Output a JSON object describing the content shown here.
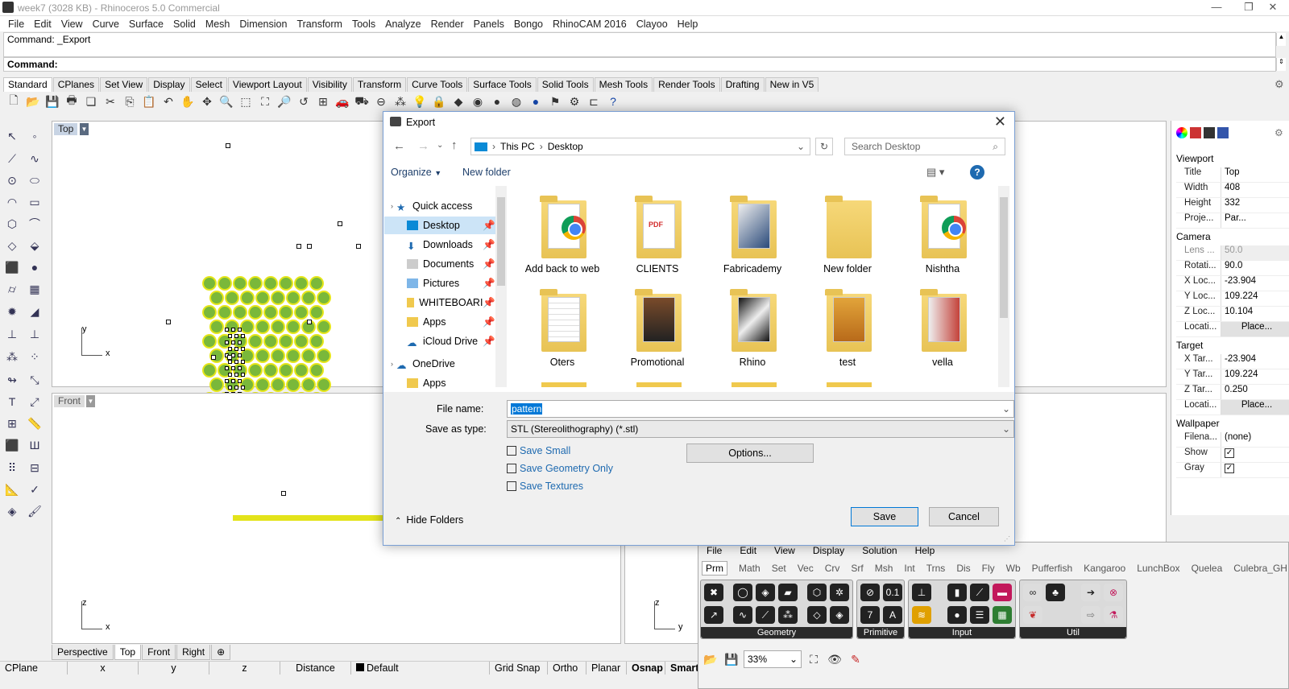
{
  "window": {
    "title": "week7 (3028 KB) - Rhinoceros 5.0 Commercial"
  },
  "menu": [
    "File",
    "Edit",
    "View",
    "Curve",
    "Surface",
    "Solid",
    "Mesh",
    "Dimension",
    "Transform",
    "Tools",
    "Analyze",
    "Render",
    "Panels",
    "Bongo",
    "RhinoCAM 2016",
    "Clayoo",
    "Help"
  ],
  "command": {
    "history": "Command: _Export",
    "prompt": "Command:"
  },
  "toolbar_tabs": [
    "Standard",
    "CPlanes",
    "Set View",
    "Display",
    "Select",
    "Viewport Layout",
    "Visibility",
    "Transform",
    "Curve Tools",
    "Surface Tools",
    "Solid Tools",
    "Mesh Tools",
    "Render Tools",
    "Drafting",
    "New in V5"
  ],
  "viewports": {
    "top": "Top",
    "front": "Front",
    "axis_y": "y",
    "axis_x": "x",
    "axis_z": "z"
  },
  "viewport_tabs": [
    "Perspective",
    "Top",
    "Front",
    "Right"
  ],
  "statusbar": [
    "CPlane",
    "x",
    "y",
    "z",
    "Distance",
    "Default",
    "Grid Snap",
    "Ortho",
    "Planar",
    "Osnap",
    "SmartT"
  ],
  "properties": {
    "viewport_header": "Viewport",
    "rows": [
      {
        "k": "Title",
        "v": "Top"
      },
      {
        "k": "Width",
        "v": "408"
      },
      {
        "k": "Height",
        "v": "332"
      },
      {
        "k": "Proje...",
        "v": "Par..."
      }
    ],
    "camera_header": "Camera",
    "camera_rows": [
      {
        "k": "Lens ...",
        "v": "50.0"
      },
      {
        "k": "Rotati...",
        "v": "90.0"
      },
      {
        "k": "X Loc...",
        "v": "-23.904"
      },
      {
        "k": "Y Loc...",
        "v": "109.224"
      },
      {
        "k": "Z Loc...",
        "v": "10.104"
      },
      {
        "k": "Locati...",
        "v": "Place..."
      }
    ],
    "target_header": "Target",
    "target_rows": [
      {
        "k": "X Tar...",
        "v": "-23.904"
      },
      {
        "k": "Y Tar...",
        "v": "109.224"
      },
      {
        "k": "Z Tar...",
        "v": "0.250"
      },
      {
        "k": "Locati...",
        "v": "Place..."
      }
    ],
    "wallpaper_header": "Wallpaper",
    "wallpaper_rows": [
      {
        "k": "Filena...",
        "v": "(none)"
      },
      {
        "k": "Show",
        "v": "✓"
      },
      {
        "k": "Gray",
        "v": "✓"
      }
    ]
  },
  "dialog": {
    "title": "Export",
    "path_this_pc": "This PC",
    "path_desktop": "Desktop",
    "search_placeholder": "Search Desktop",
    "organize": "Organize",
    "new_folder": "New folder",
    "nav": [
      {
        "label": "Quick access",
        "icon": "star-icon",
        "sel": false
      },
      {
        "label": "Desktop",
        "icon": "desktop-icon",
        "sel": true
      },
      {
        "label": "Downloads",
        "icon": "download-icon",
        "sel": false
      },
      {
        "label": "Documents",
        "icon": "documents-icon",
        "sel": false
      },
      {
        "label": "Pictures",
        "icon": "pictures-icon",
        "sel": false
      },
      {
        "label": "WHITEBOARI",
        "icon": "folder-icon",
        "sel": false
      },
      {
        "label": "Apps",
        "icon": "folder-icon",
        "sel": false
      },
      {
        "label": "iCloud Drive",
        "icon": "cloud-icon",
        "sel": false
      },
      {
        "label": "OneDrive",
        "icon": "cloud-icon",
        "sel": false
      },
      {
        "label": "Apps",
        "icon": "folder-icon",
        "sel": false
      }
    ],
    "files": [
      "Add back to web",
      "CLIENTS",
      "Fabricademy",
      "New folder",
      "Nishtha",
      "Oters",
      "Promotional",
      "Rhino",
      "test",
      "vella"
    ],
    "file_name_label": "File name:",
    "file_name": "pattern",
    "save_type_label": "Save as type:",
    "save_type": "STL (Stereolithography) (*.stl)",
    "options": [
      "Save Small",
      "Save Geometry Only",
      "Save Textures"
    ],
    "options_button": "Options...",
    "hide_folders": "Hide Folders",
    "save": "Save",
    "cancel": "Cancel"
  },
  "grasshopper": {
    "menu": [
      "File",
      "Edit",
      "View",
      "Display",
      "Solution",
      "Help"
    ],
    "tabs": [
      "Prm",
      "Math",
      "Set",
      "Vec",
      "Crv",
      "Srf",
      "Msh",
      "Int",
      "Trns",
      "Dis",
      "Fly",
      "Wb",
      "Pufferfish",
      "Kangaroo",
      "LunchBox",
      "Quelea",
      "Culebra_GH"
    ],
    "panels": [
      "Geometry",
      "Primitive",
      "Input",
      "Util"
    ],
    "zoom": "33%"
  }
}
